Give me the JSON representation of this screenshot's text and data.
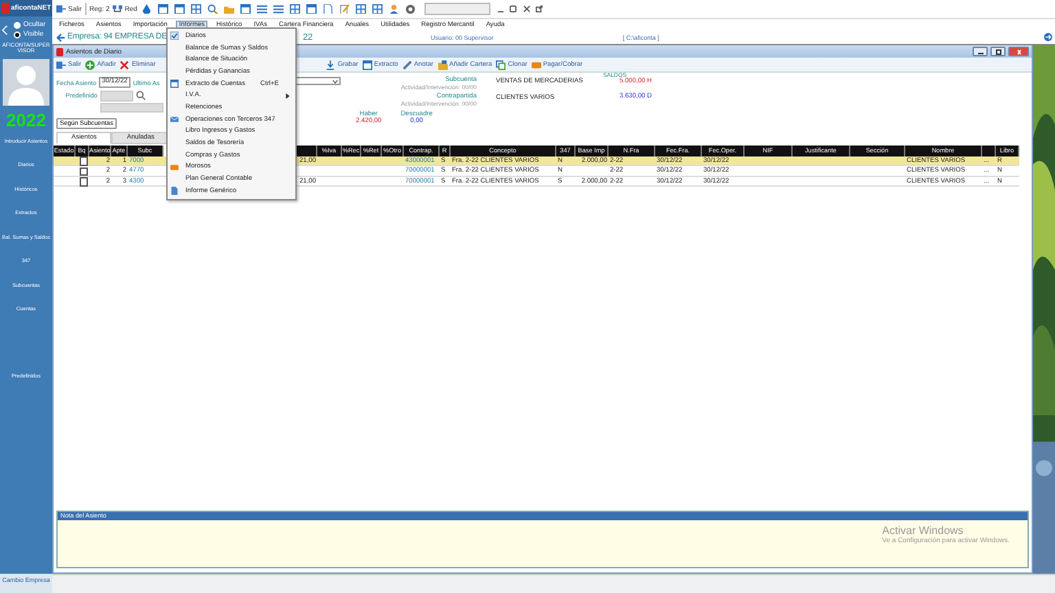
{
  "sidebar": {
    "logo": "aficontaNET",
    "visibility": [
      {
        "label": "Ocultar",
        "selected": false
      },
      {
        "label": "Visible",
        "selected": true
      }
    ],
    "user": "AFICONTA/SUPERVISOR",
    "year": "2022",
    "items": [
      "Introducir Asientos",
      "Diarios",
      "Históricos",
      "Extractos",
      "Bal. Sumas y Saldos",
      "347",
      "Subcuentas",
      "Cuentas"
    ],
    "extra_items": [
      "Predefinidos"
    ],
    "footer": "Cambio Empresa"
  },
  "toolbar": {
    "exit": "Salir",
    "register": "Reg: 2",
    "network": "Red"
  },
  "menu_bar": [
    {
      "label": "Ficheros",
      "selected": false
    },
    {
      "label": "Asientos",
      "selected": false
    },
    {
      "label": "Importación",
      "selected": false
    },
    {
      "label": "Informes",
      "selected": true
    },
    {
      "label": "Histórico",
      "selected": false
    },
    {
      "label": "IVAs",
      "selected": false
    },
    {
      "label": "Cartera Financiera",
      "selected": false
    },
    {
      "label": "Anuales",
      "selected": false
    },
    {
      "label": "Utilidades",
      "selected": false
    },
    {
      "label": "Registro Mercantil",
      "selected": false
    },
    {
      "label": "Ayuda",
      "selected": false
    }
  ],
  "company_bar": {
    "company": "Empresa: 94  EMPRESA DE",
    "company_end": "22",
    "user": "Usuario: 00  Supervisor",
    "path": "[ C:\\aficonta ]"
  },
  "menu": [
    {
      "label": "Diarios",
      "kind": "check"
    },
    {
      "label": "Balance de Sumas y Saldos",
      "kind": "plain"
    },
    {
      "label": "Balance de Situación",
      "kind": "plain"
    },
    {
      "label": "Pérdidas y Ganancias",
      "kind": "plain"
    },
    {
      "label": "Extracto de Cuentas",
      "kind": "window",
      "shortcut": "Ctrl+E"
    },
    {
      "label": "I.V.A.",
      "kind": "submenu"
    },
    {
      "label": "Retenciones",
      "kind": "plain"
    },
    {
      "label": "Operaciones con Terceros  347",
      "kind": "mail"
    },
    {
      "label": "Libro Ingresos y Gastos",
      "kind": "plain"
    },
    {
      "label": "Saldos de Tesorería",
      "kind": "plain"
    },
    {
      "label": "Compras y Gastos",
      "kind": "plain"
    },
    {
      "label": "Morosos",
      "kind": "wallet"
    },
    {
      "label": "Plan General Contable",
      "kind": "plain"
    },
    {
      "label": "Informe Genérico",
      "kind": "doc"
    }
  ],
  "window": {
    "title": "Asientos de Diario",
    "toolbar": [
      {
        "label": "Salir",
        "kind": "exit"
      },
      {
        "label": "Añadir",
        "kind": "add"
      },
      {
        "label": "Eliminar",
        "kind": "delete"
      }
    ],
    "toolbar_right": [
      {
        "label": "Grabar",
        "kind": "save"
      },
      {
        "label": "Extracto",
        "kind": "window"
      },
      {
        "label": "Anotar",
        "kind": "pen"
      },
      {
        "label": "Añadir Cartera",
        "kind": "folder"
      },
      {
        "label": "Clonar",
        "kind": "clone"
      },
      {
        "label": "Pagar/Cobrar",
        "kind": "wallet"
      }
    ],
    "form": {
      "date_label": "Fecha Asiento",
      "date": "30/12/22",
      "last_label": "Ultimo As",
      "preset_label": "Predefinido",
      "by_accounts": "Según Subcuentas",
      "account_label": "Subcuenta",
      "account_activity": "Actividad/Intervención: 00/00",
      "account_name": "VENTAS DE MERCADERIAS",
      "counter_label": "Contrapartida",
      "counter_activity": "Actividad/Intervención: 00/00",
      "counter_name": "CLIENTES VARIOS",
      "balances_label": "SALDOS",
      "account_balance": "5.000,00 H",
      "counter_balance": "3.630,00 D",
      "credit_label": "Haber",
      "credit": "2.420,00",
      "diff_label": "Descuadre",
      "diff": "0,00"
    },
    "tabs": [
      {
        "label": "Asientos",
        "selected": true
      },
      {
        "label": "Anuladas",
        "selected": false
      }
    ],
    "table": {
      "columns": [
        {
          "header": "Estado"
        },
        {
          "header": "Bq"
        },
        {
          "header": "Asiento"
        },
        {
          "header": "Apte"
        },
        {
          "header": "Subc",
          "kind": "link"
        },
        {},
        {
          "header": "%Iva"
        },
        {
          "header": "%Rec"
        },
        {
          "header": "%Ret"
        },
        {
          "header": "%Otro"
        },
        {
          "header": "Contrap.",
          "kind": "link"
        },
        {
          "header": "R"
        },
        {
          "header": "Concepto"
        },
        {
          "header": "347"
        },
        {
          "header": "Base Imp"
        },
        {
          "header": "N.Fra"
        },
        {
          "header": "Fec.Fra."
        },
        {
          "header": "Fec.Oper."
        },
        {
          "header": "NIF"
        },
        {
          "header": "Justificante"
        },
        {
          "header": "Sección"
        },
        {
          "header": "Nombre"
        },
        {},
        {
          "header": "Libro"
        }
      ],
      "rows": [
        {
          "selected": true,
          "cells": [
            null,
            false,
            "2",
            "1",
            "7000",
            "21,00",
            null,
            null,
            null,
            null,
            "43000001",
            "S",
            "Fra. 2-22 CLIENTES VARIOS",
            "N",
            "2.000,00",
            "2-22",
            "30/12/22",
            "30/12/22",
            null,
            null,
            null,
            "CLIENTES VARIOS",
            "...",
            "R"
          ]
        },
        {
          "selected": false,
          "cells": [
            null,
            false,
            "2",
            "2",
            "4770",
            null,
            null,
            null,
            null,
            null,
            "70000001",
            "S",
            "Fra. 2-22 CLIENTES VARIOS",
            "N",
            null,
            "2-22",
            "30/12/22",
            "30/12/22",
            null,
            null,
            null,
            "CLIENTES VARIOS",
            "...",
            "N"
          ]
        },
        {
          "selected": false,
          "cells": [
            null,
            false,
            "2",
            "3",
            "4300",
            "21,00",
            null,
            null,
            null,
            null,
            "70000001",
            "S",
            "Fra. 2-22 CLIENTES VARIOS",
            "S",
            "2.000,00",
            "2-22",
            "30/12/22",
            "30/12/22",
            null,
            null,
            null,
            "CLIENTES VARIOS",
            "...",
            "N"
          ]
        }
      ]
    },
    "note_label": "Nota del Asiento"
  },
  "os_notice": {
    "title": "Activar Windows",
    "text": "Ve a Configuración para activar Windows."
  }
}
